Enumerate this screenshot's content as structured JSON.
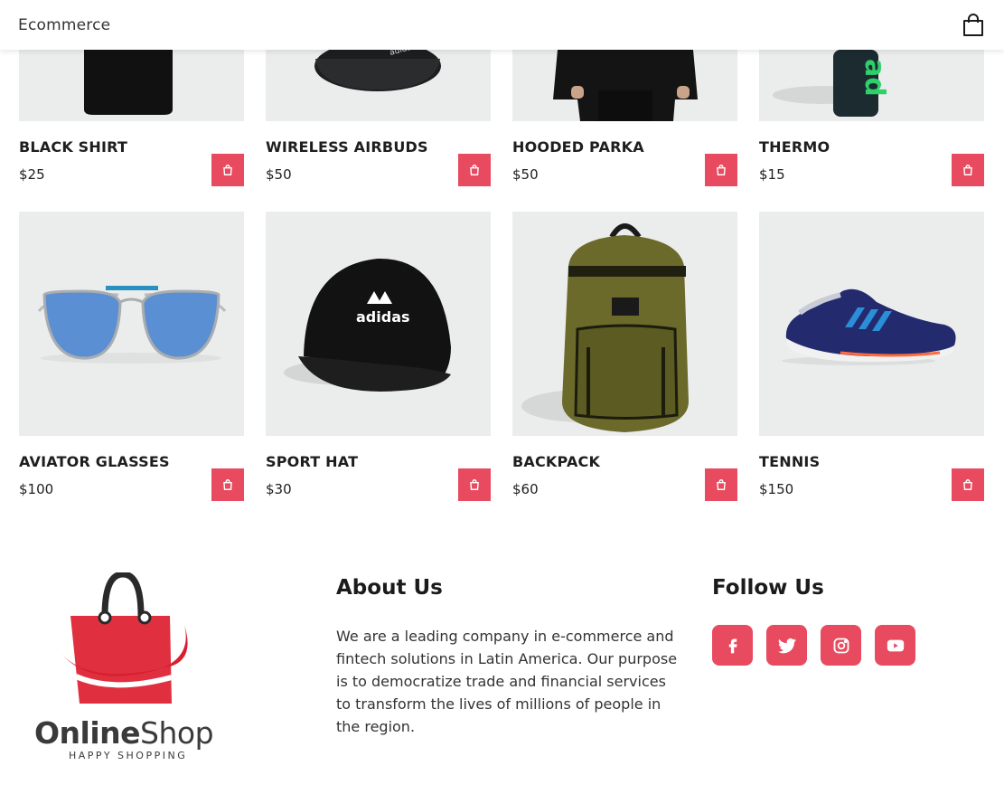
{
  "header": {
    "brand": "Ecommerce",
    "cart_icon": "shopping-bag-icon"
  },
  "products": [
    {
      "name": "BLACK SHIRT",
      "price": "$25"
    },
    {
      "name": "WIRELESS AIRBUDS",
      "price": "$50"
    },
    {
      "name": "HOODED PARKA",
      "price": "$50"
    },
    {
      "name": "THERMO",
      "price": "$15"
    },
    {
      "name": "AVIATOR GLASSES",
      "price": "$100"
    },
    {
      "name": "SPORT HAT",
      "price": "$30"
    },
    {
      "name": "BACKPACK",
      "price": "$60"
    },
    {
      "name": "TENNIS",
      "price": "$150"
    }
  ],
  "footer": {
    "logo": {
      "word_a": "Online",
      "word_b": "Shop",
      "tagline": "HAPPY SHOPPING"
    },
    "about": {
      "title": "About Us",
      "text": "We are a leading company in e-commerce and fintech solutions in Latin America. Our purpose is to democratize trade and financial services to transform the lives of millions of people in the region."
    },
    "follow": {
      "title": "Follow Us",
      "networks": [
        "facebook-icon",
        "twitter-icon",
        "instagram-icon",
        "youtube-icon"
      ]
    }
  },
  "colors": {
    "accent": "#e84a5f",
    "image_bg": "#ebeded"
  }
}
